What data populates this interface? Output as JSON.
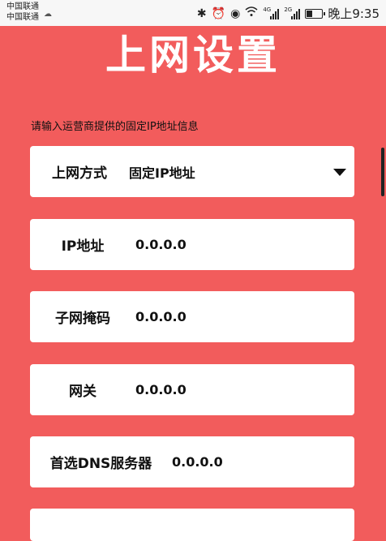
{
  "statusbar": {
    "carrier1": "中国联通",
    "carrier2": "中国联通",
    "network1": "4G",
    "network2": "2G",
    "time": "晚上9:35",
    "battery_level": 0.35,
    "icons": [
      "bluetooth-icon",
      "alarm-icon",
      "eye-icon",
      "wifi-icon",
      "signal-icon",
      "battery-icon"
    ]
  },
  "page": {
    "title": "上网设置",
    "hint": "请输入运营商提供的固定IP地址信息"
  },
  "form": {
    "mode": {
      "label": "上网方式",
      "value": "固定IP地址"
    },
    "ip": {
      "label": "IP地址",
      "value": "0.0.0.0"
    },
    "mask": {
      "label": "子网掩码",
      "value": "0.0.0.0"
    },
    "gateway": {
      "label": "网关",
      "value": "0.0.0.0"
    },
    "dns1": {
      "label": "首选DNS服务器",
      "value": "0.0.0.0"
    }
  },
  "colors": {
    "background": "#f25c5c",
    "card": "#ffffff"
  }
}
